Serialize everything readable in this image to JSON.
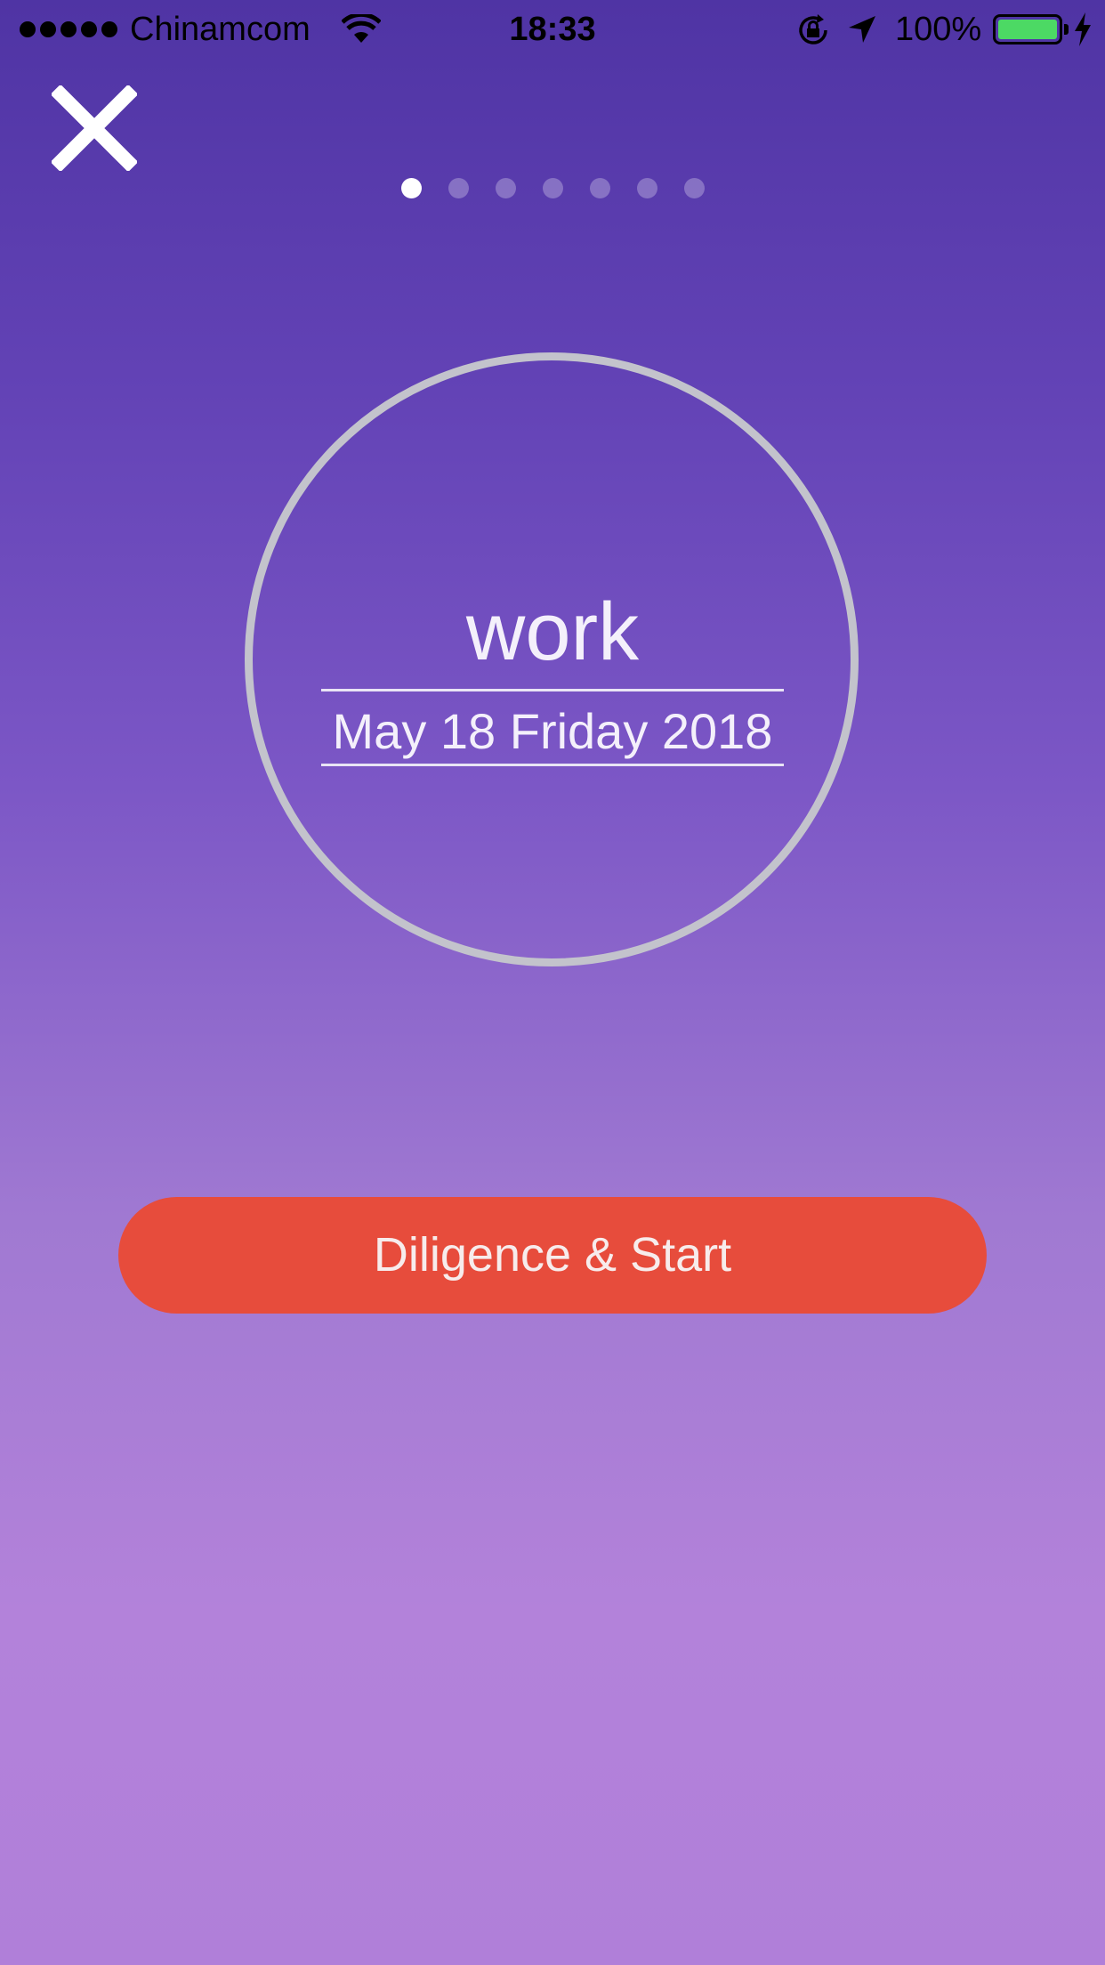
{
  "status_bar": {
    "carrier": "Chinamcom",
    "time": "18:33",
    "battery_percent": "100%",
    "signal_bars": 5,
    "battery_color": "#4cd964"
  },
  "close_button": {
    "icon": "close-icon"
  },
  "pager": {
    "total": 7,
    "active_index": 0
  },
  "task": {
    "name": "work",
    "date": "May 18 Friday 2018"
  },
  "start_button": {
    "label": "Diligence & Start",
    "color": "#e74c3c"
  },
  "colors": {
    "background_top": "#4f34a4",
    "background_bottom": "#b07fd9",
    "circle_border": "#c3c3cc"
  }
}
